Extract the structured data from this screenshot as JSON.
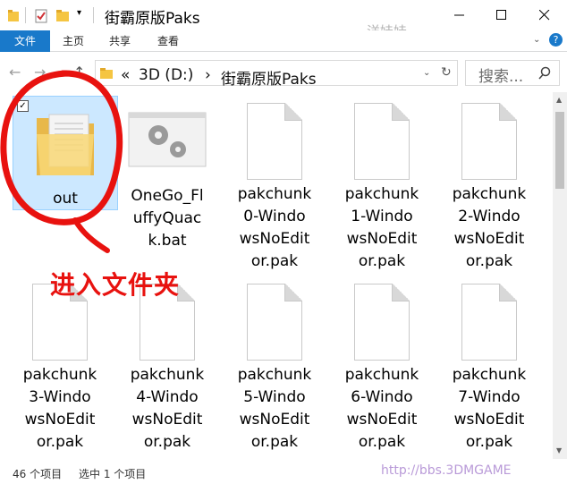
{
  "window": {
    "title": "街霸原版Paks",
    "watermark": "洋娃娃"
  },
  "ribbon": {
    "tabs": [
      "文件",
      "主页",
      "共享",
      "查看"
    ]
  },
  "address": {
    "chevron": "«",
    "drive": "3D (D:)",
    "sep": "›",
    "folder": "街霸原版Paks"
  },
  "search": {
    "placeholder": "搜索..."
  },
  "files": [
    {
      "name": "out",
      "type": "folder",
      "selected": true
    },
    {
      "name": "OneGo_FluffyQuack.bat",
      "type": "bat"
    },
    {
      "name": "pakchunk0-WindowsNoEditor.pak",
      "type": "pak"
    },
    {
      "name": "pakchunk1-WindowsNoEditor.pak",
      "type": "pak"
    },
    {
      "name": "pakchunk2-WindowsNoEditor.pak",
      "type": "pak"
    },
    {
      "name": "pakchunk3-WindowsNoEditor.pak",
      "type": "pak"
    },
    {
      "name": "pakchunk4-WindowsNoEditor.pak",
      "type": "pak"
    },
    {
      "name": "pakchunk5-WindowsNoEditor.pak",
      "type": "pak"
    },
    {
      "name": "pakchunk6-WindowsNoEditor.pak",
      "type": "pak"
    },
    {
      "name": "pakchunk7-WindowsNoEditor.pak",
      "type": "pak"
    }
  ],
  "file_labels": [
    [
      "out"
    ],
    [
      "OneGo_Fl",
      "uffyQuac",
      "k.bat"
    ],
    [
      "pakchunk",
      "0-Windo",
      "wsNoEdit",
      "or.pak"
    ],
    [
      "pakchunk",
      "1-Windo",
      "wsNoEdit",
      "or.pak"
    ],
    [
      "pakchunk",
      "2-Windo",
      "wsNoEdit",
      "or.pak"
    ],
    [
      "pakchunk",
      "3-Windo",
      "wsNoEdit",
      "or.pak"
    ],
    [
      "pakchunk",
      "4-Windo",
      "wsNoEdit",
      "or.pak"
    ],
    [
      "pakchunk",
      "5-Windo",
      "wsNoEdit",
      "or.pak"
    ],
    [
      "pakchunk",
      "6-Windo",
      "wsNoEdit",
      "or.pak"
    ],
    [
      "pakchunk",
      "7-Windo",
      "wsNoEdit",
      "or.pak"
    ]
  ],
  "status": {
    "count": "46 个项目",
    "selected": "选中 1 个项目",
    "site_watermark": "http://bbs.3DMGAME"
  },
  "annotation": "进入文件夹",
  "colors": {
    "file_tab": "#1979ca",
    "selection": "#cce8ff",
    "annotation": "#e8120f"
  }
}
